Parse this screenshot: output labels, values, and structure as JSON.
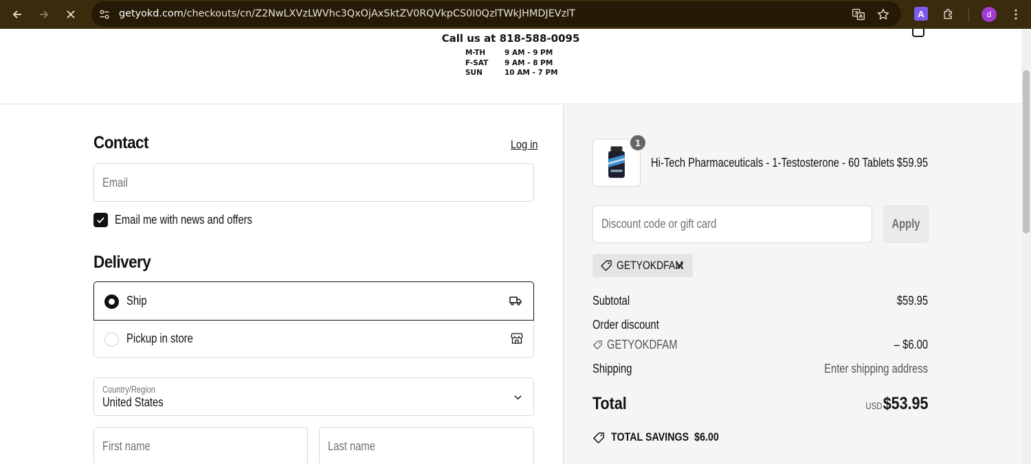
{
  "browser": {
    "url_host": "getyokd.com",
    "url_path": "/checkouts/cn/Z2NwLXVzLWVhc3QxOjAxSktZV0RQVkpCS0I0QzlTWkJHMDJEVzlT",
    "extension_label": "A",
    "profile_initial": "d"
  },
  "store_header": {
    "phone_text": "Call us at 818-588-0095",
    "hours": [
      {
        "days": "M-TH",
        "time": "9 AM - 9 PM"
      },
      {
        "days": "F-SAT",
        "time": "9 AM - 8 PM"
      },
      {
        "days": "SUN",
        "time": "10 AM - 7 PM"
      }
    ]
  },
  "contact": {
    "heading": "Contact",
    "login_label": "Log in",
    "email_placeholder": "Email",
    "newsletter_label": "Email me with news and offers",
    "newsletter_checked": true
  },
  "delivery": {
    "heading": "Delivery",
    "options": [
      {
        "label": "Ship",
        "icon": "truck-icon",
        "selected": true
      },
      {
        "label": "Pickup in store",
        "icon": "store-icon",
        "selected": false
      }
    ],
    "country_label": "Country/Region",
    "country_value": "United States",
    "first_name_placeholder": "First name",
    "last_name_placeholder": "Last name"
  },
  "summary": {
    "item": {
      "name": "Hi-Tech Pharmaceuticals - 1-Testosterone - 60 Tablets",
      "price": "$59.95",
      "quantity": "1"
    },
    "discount_placeholder": "Discount code or gift card",
    "apply_label": "Apply",
    "applied_code": "GETYOKDFAM",
    "subtotal_label": "Subtotal",
    "subtotal_value": "$59.95",
    "order_discount_label": "Order discount",
    "discount_code": "GETYOKDFAM",
    "discount_value": "– $6.00",
    "shipping_label": "Shipping",
    "shipping_value": "Enter shipping address",
    "total_label": "Total",
    "total_currency": "USD",
    "total_value": "$53.95",
    "savings_label": "TOTAL SAVINGS",
    "savings_value": "$6.00"
  },
  "colors": {
    "browser_bar": "#3b2b0d",
    "sidebar_bg": "#f5f5f5",
    "accent": "#111111"
  }
}
